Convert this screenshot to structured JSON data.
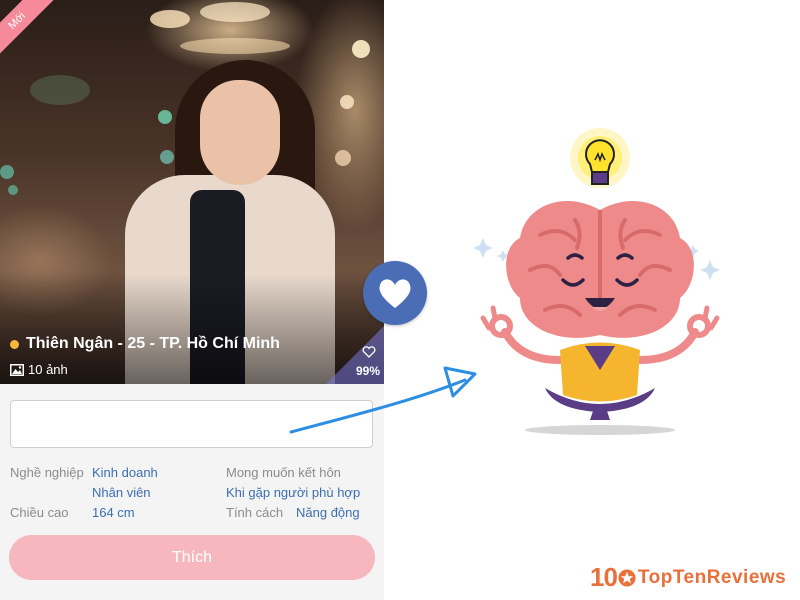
{
  "profile": {
    "new_badge": "Mới",
    "name_line": "Thiên Ngân - 25 - TP. Hồ Chí Minh",
    "photo_count": "10 ảnh",
    "match_percent": "99%",
    "message_value": "",
    "details": {
      "occupation_label": "Nghề nghiệp",
      "occupation_value_1": "Kinh doanh",
      "occupation_value_2": "Nhân viên",
      "height_label": "Chiều cao",
      "height_value": "164 cm",
      "desire_label": "Mong muốn kết hôn",
      "desire_value": "Khi gặp người phù hợp",
      "personality_label": "Tính cách",
      "personality_value": "Năng động"
    },
    "like_button": "Thích"
  },
  "logo": {
    "number": "10",
    "text": "TopTenReviews"
  },
  "icons": {
    "badge": "ribbon-badge",
    "online": "online-dot-icon",
    "photos": "image-icon",
    "match": "heart-outline-icon",
    "divider": "heart-icon",
    "arrow": "arrow-icon",
    "illustration": "meditating-brain-lightbulb",
    "logo_star": "star-icon"
  },
  "colors": {
    "badge_pink": "#f48a9a",
    "online_dot": "#f6b73c",
    "like_button_bg": "#f6b7bf",
    "heart_circle": "#4a6db5",
    "arrow_blue": "#2b8de3",
    "brand_orange": "#e8703a",
    "brain_pink": "#ef8a8a",
    "shirt_yellow": "#f5b52e",
    "pants_purple": "#5a3d86"
  }
}
